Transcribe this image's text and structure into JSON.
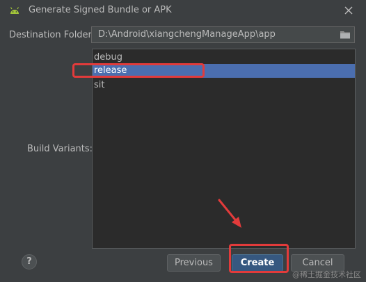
{
  "window": {
    "title": "Generate Signed Bundle or APK",
    "app_icon": "android-icon",
    "close_icon": "close-icon"
  },
  "destination": {
    "label": "Destination Folder:",
    "value": "D:\\Android\\xiangchengManageApp\\app",
    "browse_icon": "folder-icon"
  },
  "build_variants": {
    "label": "Build Variants:",
    "items": [
      {
        "label": "debug",
        "selected": false
      },
      {
        "label": "release",
        "selected": true
      },
      {
        "label": "sit",
        "selected": false
      }
    ]
  },
  "footer": {
    "help_label": "?",
    "previous_label": "Previous",
    "create_label": "Create",
    "cancel_label": "Cancel"
  },
  "watermark": "@稀土掘金技术社区",
  "colors": {
    "dialog_bg": "#3c3f41",
    "list_bg": "#2b2b2b",
    "selection": "#4b6eaf",
    "primary_button": "#365880",
    "annotation": "#e23b3b",
    "android_green": "#a4c639"
  }
}
